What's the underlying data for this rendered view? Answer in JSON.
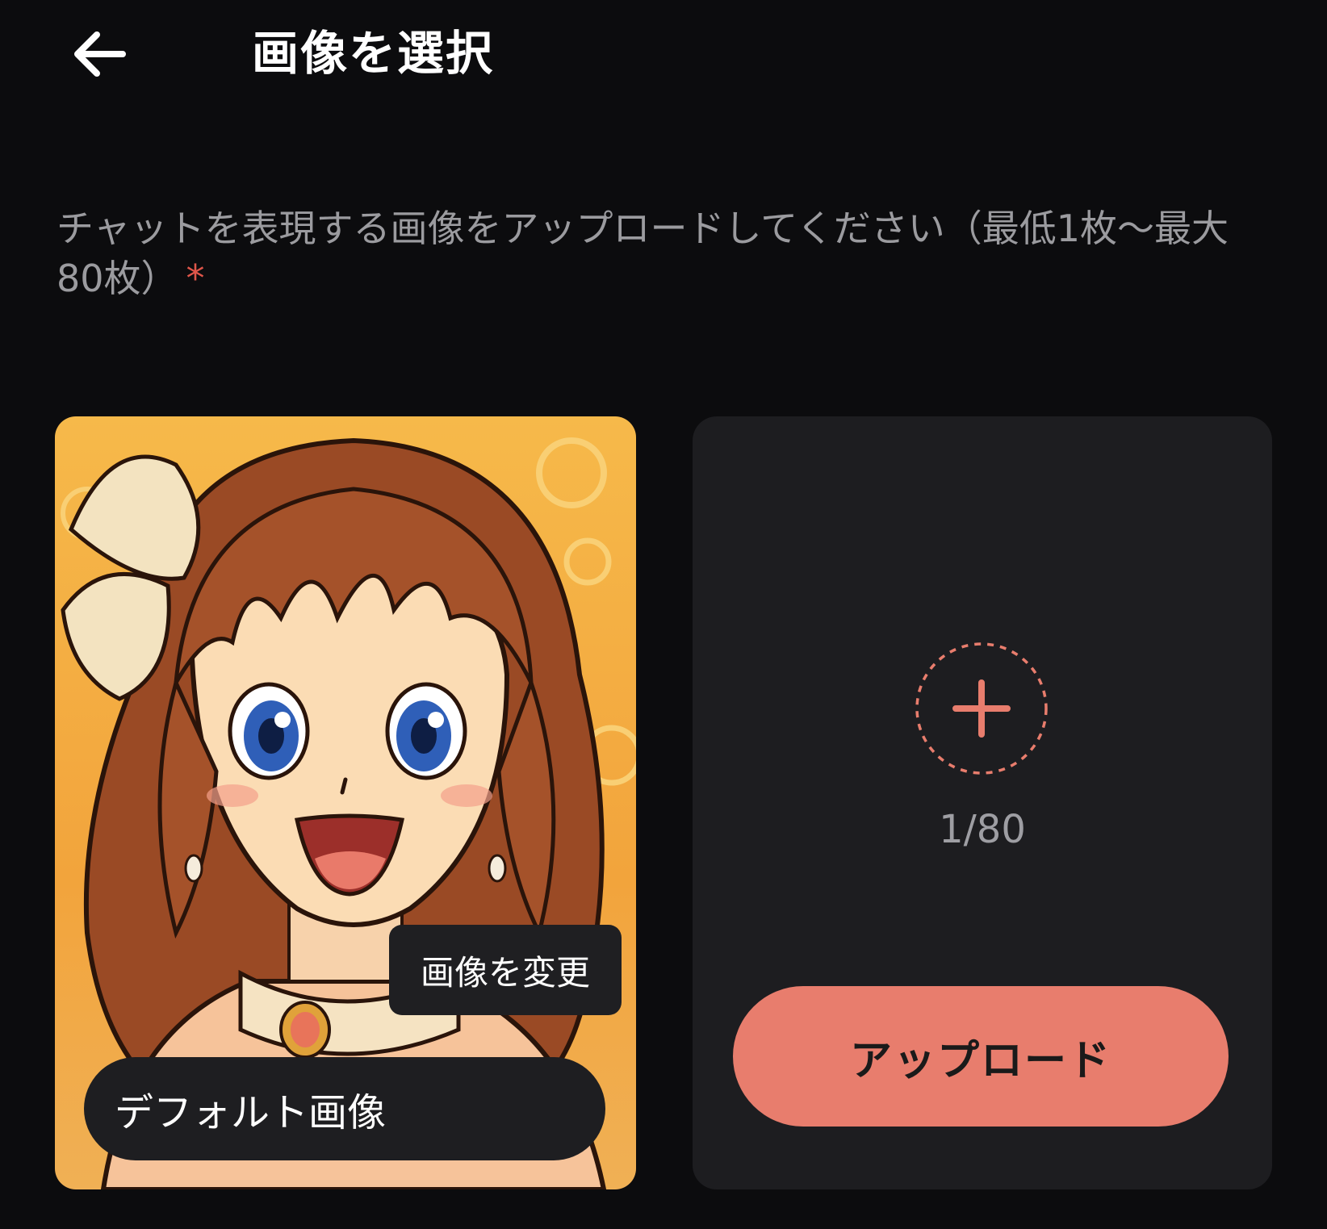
{
  "header": {
    "back_icon": "arrow-left-icon",
    "title": "画像を選択"
  },
  "instruction": {
    "text": "チャットを表現する画像をアップロードしてください（最低1枚〜最大80枚）",
    "required_mark": "*"
  },
  "default_image_card": {
    "image_description": "anime-girl-portrait",
    "change_button_label": "画像を変更",
    "label": "デフォルト画像"
  },
  "upload_card": {
    "add_icon": "plus-icon",
    "counter": "1/80",
    "upload_button_label": "アップロード"
  },
  "colors": {
    "background": "#0c0c0e",
    "card": "#1d1d20",
    "accent": "#e87d6d",
    "required": "#e0564a",
    "muted_text": "#9b9b9f"
  }
}
